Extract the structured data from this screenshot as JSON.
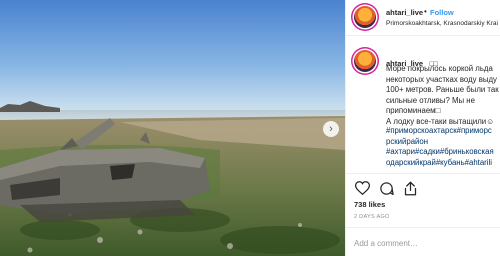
{
  "post": {
    "username": "ahtari_live",
    "follow_label": "Follow",
    "location": "Primorskoakhtarsk, Krasnodarskiy Krai",
    "caption": {
      "username": "ahtari_live",
      "emoji": "□□",
      "text": "Море покрылось коркой льда\nнекоторых участках воду выду\n100+ метров. Раньше были так\nсильные отливы? Мы не\nприпоминаем□\nА лодку все-таки вытащили☺",
      "hashtags": "#приморскоахтарск#приморс\nрскийрайон\n#ахтари#садки#бриньковская\nодарскийкрай#кубань#ahtarili"
    },
    "likes": "738 likes",
    "time": "2 DAYS AGO",
    "comment_placeholder": "Add a comment…"
  },
  "icons": {
    "like": "heart-icon",
    "comment": "comment-icon",
    "share": "share-icon",
    "next": "chevron-right-icon"
  },
  "colors": {
    "link": "#3897f0",
    "hashtag": "#003569",
    "meta": "#8e8e8e"
  }
}
